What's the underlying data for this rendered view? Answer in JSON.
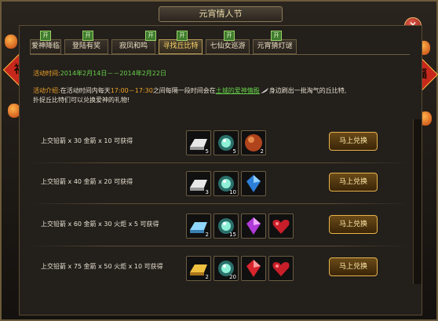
{
  "window": {
    "title": "元宵情人节",
    "close_icon": "close-icon"
  },
  "decorations": {
    "fu_char": "福"
  },
  "tabs": [
    {
      "label": "爱神降临",
      "badge": "开",
      "active": false
    },
    {
      "label": "登陆有奖",
      "badge": "开",
      "active": false
    },
    {
      "label": "寂凤和鸣",
      "badge": "开",
      "active": false
    },
    {
      "label": "寻找丘比特",
      "badge": "开",
      "active": true
    },
    {
      "label": "七仙女巡游",
      "badge": "开",
      "active": false
    },
    {
      "label": "元宵猜灯谜",
      "badge": "开",
      "active": false
    }
  ],
  "event": {
    "time_label": "活动时间:",
    "time_value": "2014年2月14日－－2014年2月22日",
    "desc_label": "活动介绍:",
    "desc_part1": "在活动时间内每天",
    "desc_time": "17:00－17:30",
    "desc_part2": "之间每隔一段时间会在",
    "desc_location": "土城的爱神情殿",
    "desc_part3": "身边刷出一批淘气的丘比特,",
    "desc_part4": "扑捉丘比特们可以兑换爱神的礼物!"
  },
  "rewards": [
    {
      "requirement": "上交铅箭 x 30 金箭 x 10 可获得",
      "items": [
        {
          "icon": "silver-bar-icon",
          "count": "5"
        },
        {
          "icon": "jade-orb-icon",
          "count": "5"
        },
        {
          "icon": "red-orb-icon",
          "count": "2"
        }
      ],
      "button": "马上兑换"
    },
    {
      "requirement": "上交铅箭 x 40 金箭 x 20 可获得",
      "items": [
        {
          "icon": "silver-bar-icon",
          "count": "3"
        },
        {
          "icon": "jade-orb-icon",
          "count": "10"
        },
        {
          "icon": "blue-crystal-icon",
          "count": ""
        }
      ],
      "button": "马上兑换"
    },
    {
      "requirement": "上交铅箭 x 60 金箭 x 30 火炬 x 5 可获得",
      "items": [
        {
          "icon": "blue-bar-icon",
          "count": "2"
        },
        {
          "icon": "jade-orb-icon",
          "count": "15"
        },
        {
          "icon": "purple-crystal-icon",
          "count": ""
        },
        {
          "icon": "heart-box-icon",
          "count": ""
        }
      ],
      "button": "马上兑换"
    },
    {
      "requirement": "上交铅箭 x 75 金箭 x 50 火炬 x 10 可获得",
      "items": [
        {
          "icon": "gold-bar-icon",
          "count": "2"
        },
        {
          "icon": "jade-orb-icon",
          "count": "20"
        },
        {
          "icon": "red-crystal-icon",
          "count": ""
        },
        {
          "icon": "heart-box-icon",
          "count": ""
        }
      ],
      "button": "马上兑换"
    }
  ]
}
